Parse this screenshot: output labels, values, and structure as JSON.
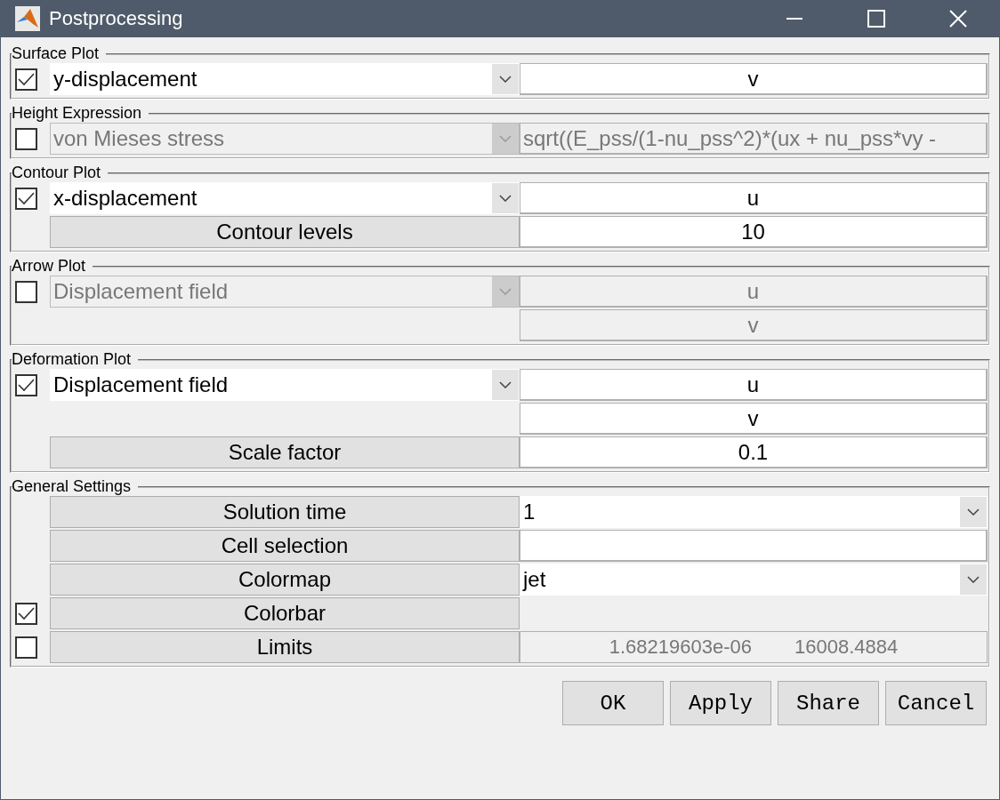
{
  "window": {
    "title": "Postprocessing"
  },
  "panels": [
    {
      "title": "Surface Plot",
      "rows": [
        {
          "checkbox": {
            "checked": true
          },
          "left": {
            "kind": "select",
            "text": "y-displacement",
            "disabled": false
          },
          "right": {
            "kind": "field",
            "text": "v",
            "disabled": false
          }
        }
      ]
    },
    {
      "title": "Height Expression",
      "rows": [
        {
          "checkbox": {
            "checked": false
          },
          "left": {
            "kind": "select",
            "text": "von Mieses stress",
            "disabled": true
          },
          "right": {
            "kind": "text",
            "text": "sqrt((E_pss/(1-nu_pss^2)*(ux + nu_pss*vy -",
            "disabled": true
          }
        }
      ]
    },
    {
      "title": "Contour Plot",
      "rows": [
        {
          "checkbox": {
            "checked": true
          },
          "left": {
            "kind": "select",
            "text": "x-displacement",
            "disabled": false
          },
          "right": {
            "kind": "field",
            "text": "u",
            "disabled": false
          }
        },
        {
          "left": {
            "kind": "button",
            "text": "Contour levels"
          },
          "right": {
            "kind": "field",
            "text": "10",
            "disabled": false
          }
        }
      ]
    },
    {
      "title": "Arrow Plot",
      "rows": [
        {
          "checkbox": {
            "checked": false
          },
          "left": {
            "kind": "select",
            "text": "Displacement field",
            "disabled": true
          },
          "right": {
            "kind": "field",
            "text": "u",
            "disabled": true
          }
        },
        {
          "left": {
            "kind": "none"
          },
          "right": {
            "kind": "field",
            "text": "v",
            "disabled": true
          }
        }
      ]
    },
    {
      "title": "Deformation Plot",
      "rows": [
        {
          "checkbox": {
            "checked": true
          },
          "left": {
            "kind": "select",
            "text": "Displacement field",
            "disabled": false
          },
          "right": {
            "kind": "field",
            "text": "u",
            "disabled": false
          }
        },
        {
          "left": {
            "kind": "none"
          },
          "right": {
            "kind": "field",
            "text": "v",
            "disabled": false
          }
        },
        {
          "left": {
            "kind": "button",
            "text": "Scale factor"
          },
          "right": {
            "kind": "field",
            "text": "0.1",
            "disabled": false
          }
        }
      ]
    },
    {
      "title": "General Settings",
      "rows": [
        {
          "left": {
            "kind": "button",
            "text": "Solution time"
          },
          "right": {
            "kind": "select",
            "text": "1",
            "disabled": false
          }
        },
        {
          "left": {
            "kind": "button",
            "text": "Cell selection"
          },
          "right": {
            "kind": "text",
            "disabled": false
          }
        },
        {
          "left": {
            "kind": "button",
            "text": "Colormap"
          },
          "right": {
            "kind": "select",
            "text": "jet",
            "disabled": false
          }
        },
        {
          "checkbox": {
            "checked": true
          },
          "left": {
            "kind": "button",
            "text": "Colorbar"
          },
          "right": {
            "kind": "none"
          }
        },
        {
          "checkbox": {
            "checked": false
          },
          "left": {
            "kind": "button",
            "text": "Limits"
          },
          "right": {
            "kind": "limits",
            "values": [
              "1.68219603e-06",
              "16008.4884"
            ]
          }
        }
      ]
    }
  ],
  "buttons": [
    "OK",
    "Apply",
    "Share",
    "Cancel"
  ]
}
